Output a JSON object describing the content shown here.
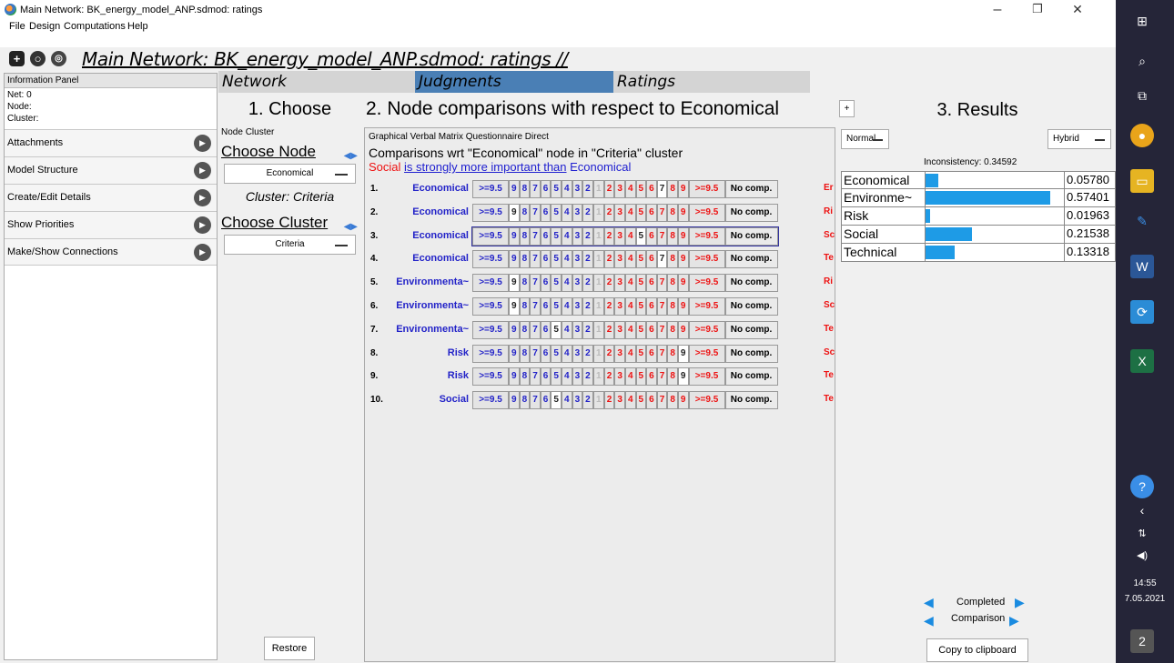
{
  "window": {
    "title": "Main Network: BK_energy_model_ANP.sdmod: ratings",
    "controls": {
      "minimize": "–",
      "maximize": "❐",
      "close": "✕"
    }
  },
  "menu": [
    "File",
    "Design",
    "Computations",
    "Help"
  ],
  "path": "Main Network: BK_energy_model_ANP.sdmod: ratings //",
  "info_panel": {
    "header": "Information Panel",
    "net": "Net: 0",
    "node": "Node:",
    "cluster": "Cluster:",
    "buttons": [
      "Attachments",
      "Model Structure",
      "Create/Edit Details",
      "Show Priorities",
      "Make/Show Connections"
    ]
  },
  "tabs": {
    "network": "Network",
    "judgments": "Judgments",
    "ratings": "Ratings"
  },
  "choose": {
    "title": "1. Choose",
    "subtabs": [
      "Node",
      "Cluster"
    ],
    "choose_node": "Choose Node",
    "node_value": "Economical",
    "cluster_label": "Cluster: Criteria",
    "choose_cluster": "Choose Cluster",
    "cluster_value": "Criteria",
    "restore": "Restore"
  },
  "comparisons": {
    "title": "2. Node comparisons with respect to Economical",
    "plus": "+",
    "modes": [
      "Graphical",
      "Verbal",
      "Matrix",
      "Questionnaire",
      "Direct"
    ],
    "heading": "Comparisons wrt \"Economical\" node in \"Criteria\" cluster",
    "verbal_a": "Social",
    "verbal_mid": "is strongly more important than",
    "verbal_b": "Economical",
    "scale_left": ">=9.5",
    "scale_right": ">=9.5",
    "no_comp": "No comp.",
    "rows": [
      {
        "num": "1.",
        "name": "Economical",
        "right": "Er",
        "selected": "r7"
      },
      {
        "num": "2.",
        "name": "Economical",
        "right": "Ri",
        "selected": "l9"
      },
      {
        "num": "3.",
        "name": "Economical",
        "right": "Sc",
        "selected": "r5",
        "highlight": true
      },
      {
        "num": "4.",
        "name": "Economical",
        "right": "Te",
        "selected": "r7"
      },
      {
        "num": "5.",
        "name": "Environmenta~",
        "right": "Ri",
        "selected": "l9"
      },
      {
        "num": "6.",
        "name": "Environmenta~",
        "right": "Sc",
        "selected": "l9"
      },
      {
        "num": "7.",
        "name": "Environmenta~",
        "right": "Te",
        "selected": "l5"
      },
      {
        "num": "8.",
        "name": "Risk",
        "right": "Sc",
        "selected": "r9"
      },
      {
        "num": "9.",
        "name": "Risk",
        "right": "Te",
        "selected": "r9"
      },
      {
        "num": "10.",
        "name": "Social",
        "right": "Te",
        "selected": "l5"
      }
    ]
  },
  "results": {
    "title": "3. Results",
    "mode_left": "Normal",
    "mode_right": "Hybrid",
    "inconsistency": "Inconsistency: 0.34592",
    "rows": [
      {
        "name": "Economical",
        "value": "0.05780",
        "fraction": 0.0578
      },
      {
        "name": "Environme~",
        "value": "0.57401",
        "fraction": 0.574
      },
      {
        "name": " Risk",
        "value": "0.01963",
        "fraction": 0.0196
      },
      {
        "name": " Social",
        "value": "0.21538",
        "fraction": 0.2154
      },
      {
        "name": "Technical",
        "value": "0.13318",
        "fraction": 0.1332
      }
    ],
    "completed": "Completed",
    "comparison": "Comparison",
    "copy": "Copy to clipboard"
  },
  "taskbar": {
    "time": "14:55",
    "date": "7.05.2021",
    "notif_count": "2"
  },
  "colors": {
    "accent": "#1e9be6",
    "tab_active": "#4a7fb5",
    "link_blue": "#2323c8",
    "red": "#e11111"
  }
}
